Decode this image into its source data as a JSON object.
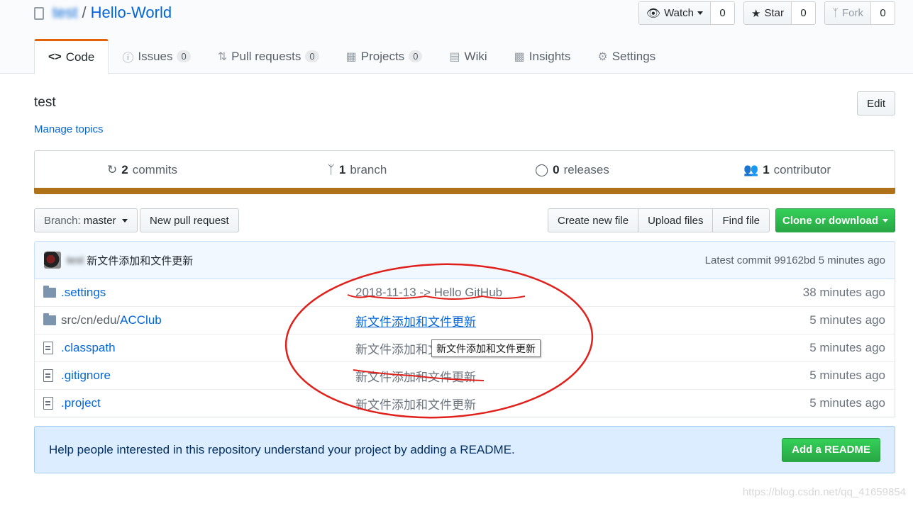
{
  "repo": {
    "owner": "test",
    "separator": "/",
    "name": "Hello-World"
  },
  "actions": {
    "watch_label": "Watch",
    "watch_count": "0",
    "star_label": "Star",
    "star_count": "0",
    "fork_label": "Fork",
    "fork_count": "0"
  },
  "tabs": [
    {
      "label": "Code",
      "icon": "code-icon"
    },
    {
      "label": "Issues",
      "count": "0",
      "icon": "issue-icon"
    },
    {
      "label": "Pull requests",
      "count": "0",
      "icon": "pull-request-icon"
    },
    {
      "label": "Projects",
      "count": "0",
      "icon": "project-icon"
    },
    {
      "label": "Wiki",
      "icon": "book-icon"
    },
    {
      "label": "Insights",
      "icon": "graph-icon"
    },
    {
      "label": "Settings",
      "icon": "gear-icon"
    }
  ],
  "description": "test",
  "manage_topics": "Manage topics",
  "edit_label": "Edit",
  "summary": {
    "commits_count": "2",
    "commits_label": "commits",
    "branch_count": "1",
    "branch_label": "branch",
    "releases_count": "0",
    "releases_label": "releases",
    "contributor_count": "1",
    "contributor_label": "contributor"
  },
  "language_color": "#b07219",
  "file_nav": {
    "branch_prefix": "Branch:",
    "branch_name": "master",
    "new_pr": "New pull request",
    "create_file": "Create new file",
    "upload_files": "Upload files",
    "find_file": "Find file",
    "clone": "Clone or download"
  },
  "latest_commit": {
    "author": "test",
    "message": "新文件添加和文件更新",
    "meta": "Latest commit 99162bd 5 minutes ago"
  },
  "files": [
    {
      "type": "folder",
      "name": ".settings",
      "message": "2018-11-13 -> Hello GitHub",
      "age": "38 minutes ago"
    },
    {
      "type": "folder",
      "path": "src/cn/edu/",
      "name": "ACClub",
      "message": "新文件添加和文件更新",
      "age": "5 minutes ago"
    },
    {
      "type": "file",
      "name": ".classpath",
      "message": "新文件添加和文件更新",
      "age": "5 minutes ago"
    },
    {
      "type": "file",
      "name": ".gitignore",
      "message": "新文件添加和文件更新",
      "age": "5 minutes ago"
    },
    {
      "type": "file",
      "name": ".project",
      "message": "新文件添加和文件更新",
      "age": "5 minutes ago"
    }
  ],
  "tooltip": "新文件添加和文件更新",
  "readme_prompt": {
    "text": "Help people interested in this repository understand your project by adding a README.",
    "button": "Add a README"
  },
  "watermark": "https://blog.csdn.net/qq_41659854",
  "colors": {
    "link": "#0366d6",
    "accent_tab": "#e36209",
    "green": "#28a745",
    "annotation": "#e0201b"
  }
}
